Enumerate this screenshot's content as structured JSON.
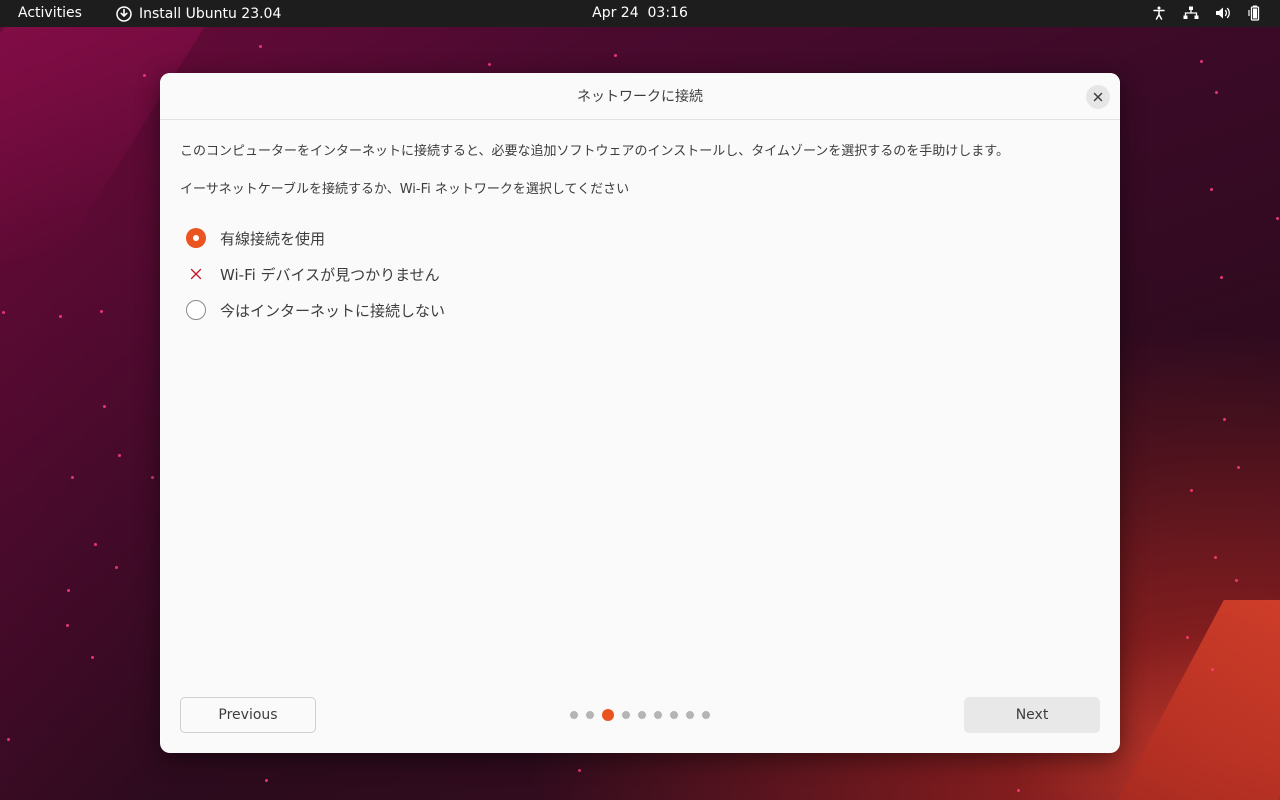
{
  "topbar": {
    "activities": "Activities",
    "app_title": "Install Ubuntu 23.04",
    "date": "Apr 24",
    "time": "03:16"
  },
  "dialog": {
    "title": "ネットワークに接続",
    "description": "このコンピューターをインターネットに接続すると、必要な追加ソフトウェアのインストールし、タイムゾーンを選択するのを手助けします。",
    "instruction": "イーサネットケーブルを接続するか、Wi-Fi ネットワークを選択してください",
    "options": [
      {
        "label": "有線接続を使用",
        "state": "selected"
      },
      {
        "label": "Wi-Fi デバイスが見つかりません",
        "state": "unavailable"
      },
      {
        "label": "今はインターネットに接続しない",
        "state": "unselected"
      }
    ],
    "previous_label": "Previous",
    "next_label": "Next",
    "pager": {
      "total": 9,
      "current": 3
    }
  },
  "colors": {
    "accent": "#e95420",
    "error": "#c7162b",
    "topbar": "#1d1d1d"
  }
}
